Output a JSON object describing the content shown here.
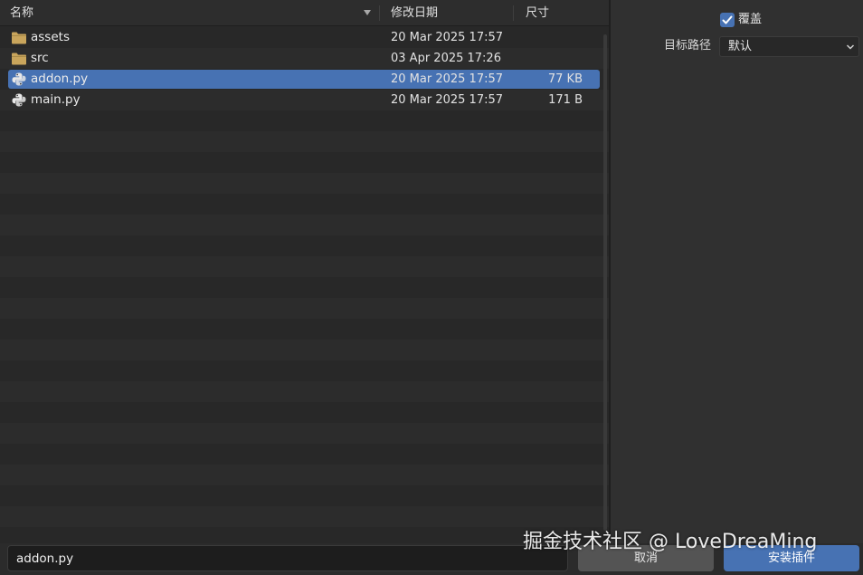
{
  "columns": {
    "name": "名称",
    "modified": "修改日期",
    "size": "尺寸"
  },
  "files": [
    {
      "icon": "folder-icon",
      "name": "assets",
      "modified": "20 Mar 2025 17:57",
      "size": "",
      "selected": false
    },
    {
      "icon": "folder-icon",
      "name": "src",
      "modified": "03 Apr 2025 17:26",
      "size": "",
      "selected": false
    },
    {
      "icon": "python-file-icon",
      "name": "addon.py",
      "modified": "20 Mar 2025 17:57",
      "size": "77 KB",
      "selected": true
    },
    {
      "icon": "python-file-icon",
      "name": "main.py",
      "modified": "20 Mar 2025 17:57",
      "size": "171 B",
      "selected": false
    }
  ],
  "options": {
    "overwrite_label": "覆盖",
    "overwrite_checked": true,
    "target_path_label": "目标路径",
    "target_path_value": "默认"
  },
  "footer": {
    "filename_value": "addon.py",
    "cancel_label": "取消",
    "install_label": "安装插件"
  },
  "watermark": "掘金技术社区 @ LoveDreaMing",
  "colors": {
    "accent": "#4772b3",
    "folder": "#c9a55c",
    "background": "#282828"
  }
}
